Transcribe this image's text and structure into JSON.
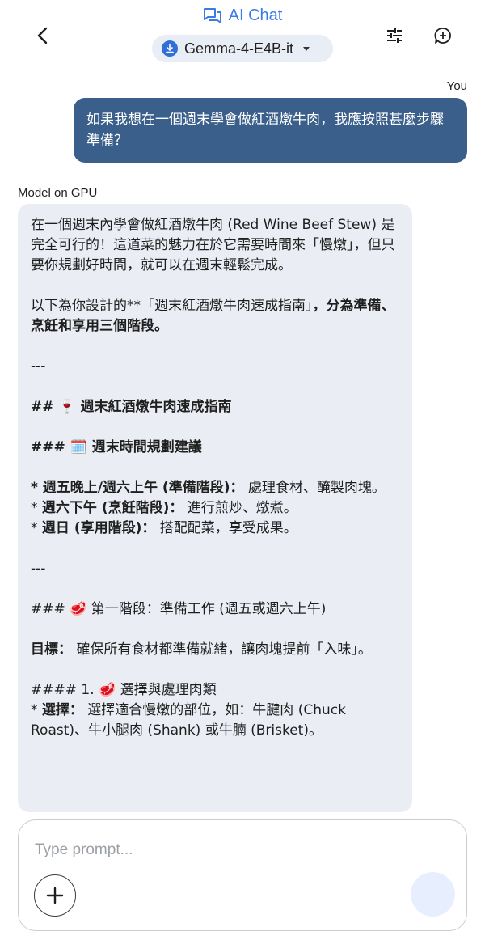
{
  "header": {
    "app_title": "AI Chat",
    "model_name": "Gemma-4-E4B-it"
  },
  "icons": {
    "back": "chevron-left-icon",
    "chat": "chat-bubbles-icon",
    "download": "download-icon",
    "dropdown": "caret-down-icon",
    "tune": "tune-sliders-icon",
    "new_chat": "add-chat-icon",
    "add": "plus-icon"
  },
  "colors": {
    "accent": "#3a7be8",
    "user_bubble": "#3a5f8a",
    "model_bubble": "#eaeef4",
    "chip_bg": "#e9eef6"
  },
  "user_message": {
    "label": "You",
    "text": "如果我想在一個週末學會做紅酒燉牛肉，我應按照甚麼步驟準備？"
  },
  "model_message": {
    "label": "Model on GPU",
    "p1": "在一個週末內學會做紅酒燉牛肉 (Red Wine Beef Stew) 是完全可行的！這道菜的魅力在於它需要時間來「慢燉」，但只要你規劃好時間，就可以在週末輕鬆完成。",
    "p2_normal": "以下為你設計的**「週末紅酒燉牛肉速成指南」",
    "p2_bold": "，分為準備、烹飪和享用三個階段。",
    "divider1": "---",
    "h2": "## 🍷 週末紅酒燉牛肉速成指南",
    "h3_schedule": "### 🗓️ 週末時間規劃建議",
    "s1_bold": "* 週五晚上/週六上午 (準備階段)：",
    "s1_text": " 處理食材、醃製肉塊。",
    "s2_prefix": "* ",
    "s2_bold": "週六下午 (烹飪階段)：",
    "s2_text": " 進行煎炒、燉煮。",
    "s3_prefix": "* ",
    "s3_bold": "週日 (享用階段)：",
    "s3_text": " 搭配配菜，享受成果。",
    "divider2": "---",
    "h3_stage1": "### 🥩 第一階段：準備工作 (週五或週六上午)",
    "goal_bold": "目標：",
    "goal_text": " 確保所有食材都準備就緒，讓肉塊提前「入味」。",
    "h4_meat": "#### 1. 🥩 選擇與處理肉類",
    "choose_prefix": "* ",
    "choose_bold": "選擇：",
    "choose_text": " 選擇適合慢燉的部位，如：牛腱肉 (Chuck Roast)、牛小腿肉 (Shank) 或牛腩 (Brisket)。"
  },
  "prompt": {
    "placeholder": "Type prompt...",
    "value": ""
  }
}
